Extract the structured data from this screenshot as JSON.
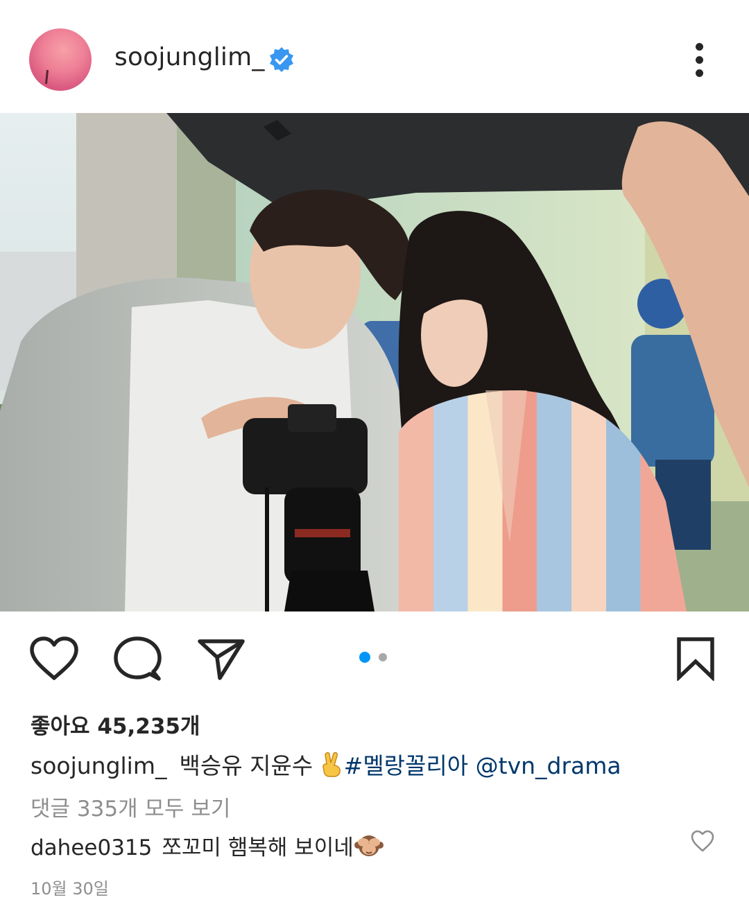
{
  "post": {
    "username": "soojunglim_",
    "verified": true,
    "likes_text": "좋아요 45,235개",
    "caption": {
      "username": "soojunglim_",
      "text": "백승유 지윤수",
      "emoji": "victory-hand",
      "hashtag": "#멜랑꼴리아",
      "mention": "@tvn_drama"
    },
    "view_comments": "댓글 335개 모두 보기",
    "top_comment": {
      "username": "dahee0315",
      "text": "쪼꼬미 햄복해 보이네",
      "emoji": "see-no-evil-monkey"
    },
    "date": "10월 30일",
    "carousel": {
      "current": 1,
      "total": 2
    }
  },
  "icons": {
    "like": "heart-icon",
    "comment": "comment-bubble-icon",
    "share": "paper-plane-icon",
    "save": "bookmark-icon",
    "more": "more-vertical-icon"
  },
  "colors": {
    "verified": "#3897f0",
    "link": "#00376b",
    "muted": "#8e8e8e",
    "active_dot": "#0095f6"
  }
}
